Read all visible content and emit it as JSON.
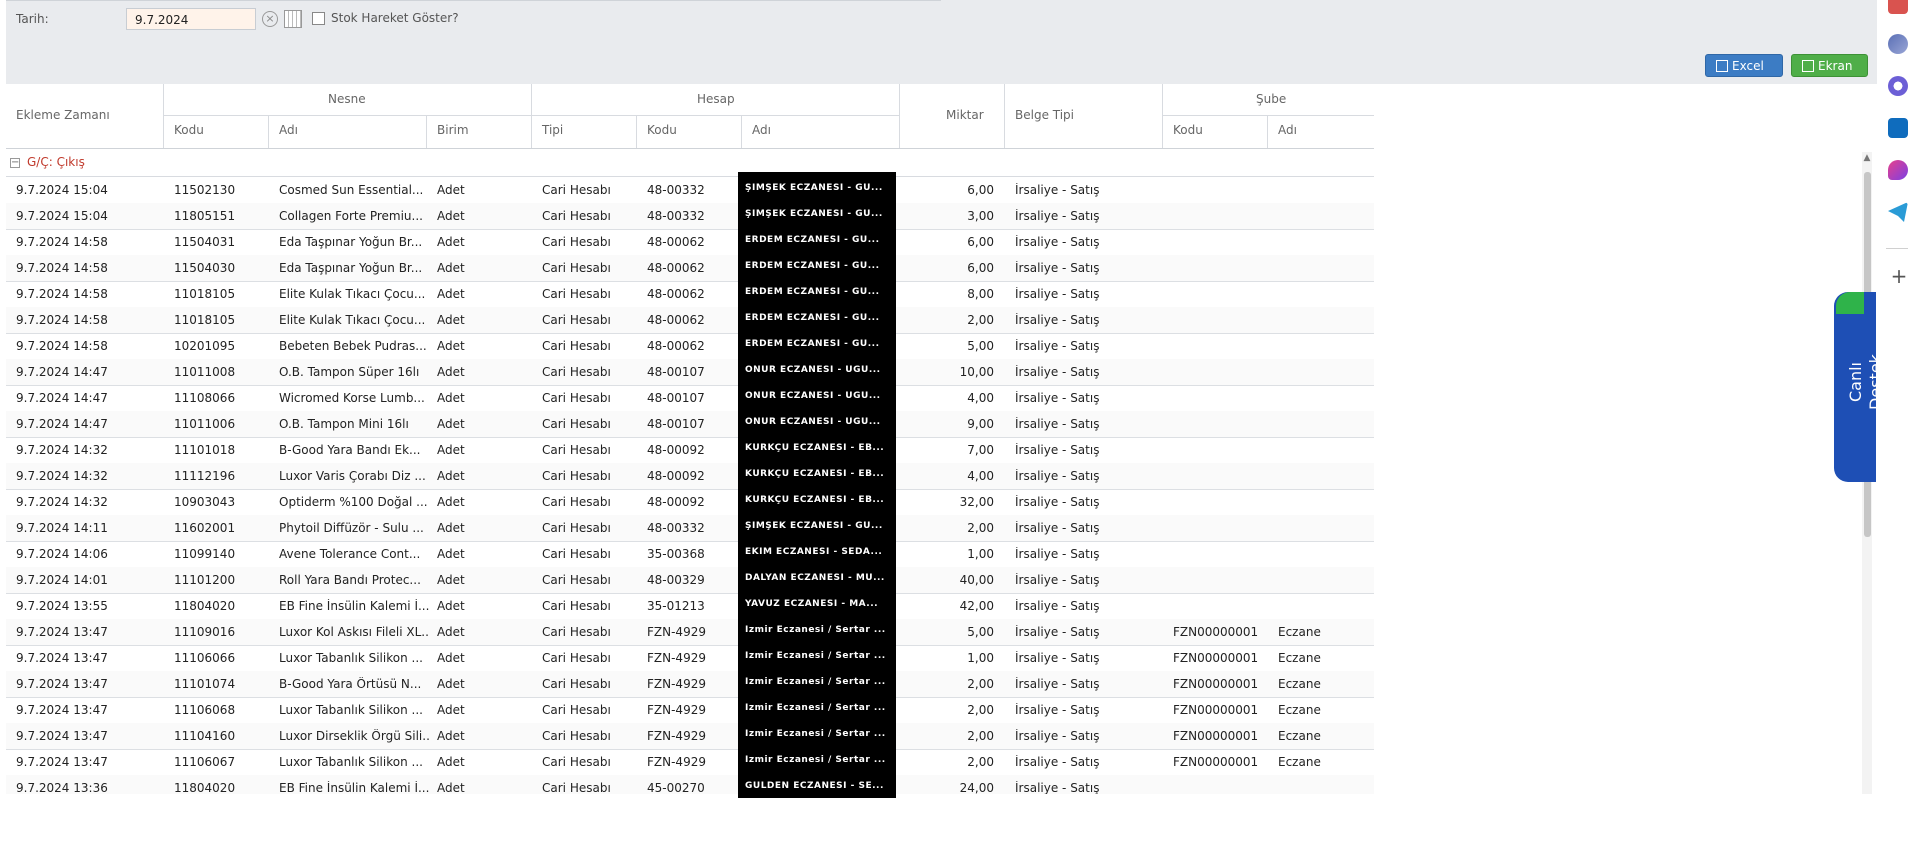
{
  "filter": {
    "date_label": "Tarih:",
    "date_value": "9.7.2024",
    "checkbox_label": "Stok Hareket Göster?"
  },
  "toolbar": {
    "excel_label": "Excel",
    "ekran_label": "Ekran"
  },
  "headers": {
    "ekleme": "Ekleme Zamanı",
    "nesne": "Nesne",
    "nesne_kodu": "Kodu",
    "nesne_adi": "Adı",
    "birim": "Birim",
    "hesap": "Hesap",
    "hesap_tipi": "Tipi",
    "hesap_kodu": "Kodu",
    "hesap_adi": "Adı",
    "miktar": "Miktar",
    "belge_tipi": "Belge Tipi",
    "sube": "Şube",
    "sube_kodu": "Kodu",
    "sube_adi": "Adı"
  },
  "group": {
    "title": "G/Ç: Çıkış",
    "toggle": "−"
  },
  "rows": [
    {
      "time": "9.7.2024 15:04",
      "kod": "11502130",
      "adi": "Cosmed Sun Essential...",
      "birim": "Adet",
      "tipi": "Cari Hesabı",
      "hkod": "48-00332",
      "hadi": "ŞİMŞEK ECZANESİ - GÜ...",
      "miktar": "6,00",
      "belge": "İrsaliye - Satış",
      "skod": "",
      "sadi": ""
    },
    {
      "time": "9.7.2024 15:04",
      "kod": "11805151",
      "adi": "Collagen Forte Premiu...",
      "birim": "Adet",
      "tipi": "Cari Hesabı",
      "hkod": "48-00332",
      "hadi": "ŞİMŞEK ECZANESİ - GÜ...",
      "miktar": "3,00",
      "belge": "İrsaliye - Satış",
      "skod": "",
      "sadi": ""
    },
    {
      "time": "9.7.2024 14:58",
      "kod": "11504031",
      "adi": "Eda Taşpınar Yoğun Br...",
      "birim": "Adet",
      "tipi": "Cari Hesabı",
      "hkod": "48-00062",
      "hadi": "ERDEM ECZANESİ - GÜ...",
      "miktar": "6,00",
      "belge": "İrsaliye - Satış",
      "skod": "",
      "sadi": ""
    },
    {
      "time": "9.7.2024 14:58",
      "kod": "11504030",
      "adi": "Eda Taşpınar Yoğun Br...",
      "birim": "Adet",
      "tipi": "Cari Hesabı",
      "hkod": "48-00062",
      "hadi": "ERDEM ECZANESİ - GÜ...",
      "miktar": "6,00",
      "belge": "İrsaliye - Satış",
      "skod": "",
      "sadi": ""
    },
    {
      "time": "9.7.2024 14:58",
      "kod": "11018105",
      "adi": "Elite Kulak Tıkacı Çocu...",
      "birim": "Adet",
      "tipi": "Cari Hesabı",
      "hkod": "48-00062",
      "hadi": "ERDEM ECZANESİ - GÜ...",
      "miktar": "8,00",
      "belge": "İrsaliye - Satış",
      "skod": "",
      "sadi": ""
    },
    {
      "time": "9.7.2024 14:58",
      "kod": "11018105",
      "adi": "Elite Kulak Tıkacı Çocu...",
      "birim": "Adet",
      "tipi": "Cari Hesabı",
      "hkod": "48-00062",
      "hadi": "ERDEM ECZANESİ - GÜ...",
      "miktar": "2,00",
      "belge": "İrsaliye - Satış",
      "skod": "",
      "sadi": ""
    },
    {
      "time": "9.7.2024 14:58",
      "kod": "10201095",
      "adi": "Bebeten Bebek Pudras...",
      "birim": "Adet",
      "tipi": "Cari Hesabı",
      "hkod": "48-00062",
      "hadi": "ERDEM ECZANESİ - GÜ...",
      "miktar": "5,00",
      "belge": "İrsaliye - Satış",
      "skod": "",
      "sadi": ""
    },
    {
      "time": "9.7.2024 14:47",
      "kod": "11011008",
      "adi": "O.B. Tampon Süper 16lı",
      "birim": "Adet",
      "tipi": "Cari Hesabı",
      "hkod": "48-00107",
      "hadi": "ONUR ECZANESİ - UĞU...",
      "miktar": "10,00",
      "belge": "İrsaliye - Satış",
      "skod": "",
      "sadi": ""
    },
    {
      "time": "9.7.2024 14:47",
      "kod": "11108066",
      "adi": "Wicromed Korse Lumb...",
      "birim": "Adet",
      "tipi": "Cari Hesabı",
      "hkod": "48-00107",
      "hadi": "ONUR ECZANESİ - UĞU...",
      "miktar": "4,00",
      "belge": "İrsaliye - Satış",
      "skod": "",
      "sadi": ""
    },
    {
      "time": "9.7.2024 14:47",
      "kod": "11011006",
      "adi": "O.B. Tampon Mini 16lı",
      "birim": "Adet",
      "tipi": "Cari Hesabı",
      "hkod": "48-00107",
      "hadi": "ONUR ECZANESİ - UĞU...",
      "miktar": "9,00",
      "belge": "İrsaliye - Satış",
      "skod": "",
      "sadi": ""
    },
    {
      "time": "9.7.2024 14:32",
      "kod": "11101018",
      "adi": "B-Good Yara Bandı Ek...",
      "birim": "Adet",
      "tipi": "Cari Hesabı",
      "hkod": "48-00092",
      "hadi": "KÜRKÇÜ ECZANESİ - EB...",
      "miktar": "7,00",
      "belge": "İrsaliye - Satış",
      "skod": "",
      "sadi": ""
    },
    {
      "time": "9.7.2024 14:32",
      "kod": "11112196",
      "adi": "Luxor Varis Çorabı Diz ...",
      "birim": "Adet",
      "tipi": "Cari Hesabı",
      "hkod": "48-00092",
      "hadi": "KÜRKÇÜ ECZANESİ - EB...",
      "miktar": "4,00",
      "belge": "İrsaliye - Satış",
      "skod": "",
      "sadi": ""
    },
    {
      "time": "9.7.2024 14:32",
      "kod": "10903043",
      "adi": "Optiderm %100 Doğal ...",
      "birim": "Adet",
      "tipi": "Cari Hesabı",
      "hkod": "48-00092",
      "hadi": "KÜRKÇÜ ECZANESİ - EB...",
      "miktar": "32,00",
      "belge": "İrsaliye - Satış",
      "skod": "",
      "sadi": ""
    },
    {
      "time": "9.7.2024 14:11",
      "kod": "11602001",
      "adi": "Phytoil Diffüzör - Sulu ...",
      "birim": "Adet",
      "tipi": "Cari Hesabı",
      "hkod": "48-00332",
      "hadi": "ŞİMŞEK ECZANESİ - GÜ...",
      "miktar": "2,00",
      "belge": "İrsaliye - Satış",
      "skod": "",
      "sadi": ""
    },
    {
      "time": "9.7.2024 14:06",
      "kod": "11099140",
      "adi": "Avene Tolerance Cont...",
      "birim": "Adet",
      "tipi": "Cari Hesabı",
      "hkod": "35-00368",
      "hadi": "EKİM ECZANESİ - SEDA...",
      "miktar": "1,00",
      "belge": "İrsaliye - Satış",
      "skod": "",
      "sadi": ""
    },
    {
      "time": "9.7.2024 14:01",
      "kod": "11101200",
      "adi": "Roll Yara Bandı Protec...",
      "birim": "Adet",
      "tipi": "Cari Hesabı",
      "hkod": "48-00329",
      "hadi": "DALYAN ECZANESİ - MU...",
      "miktar": "40,00",
      "belge": "İrsaliye - Satış",
      "skod": "",
      "sadi": ""
    },
    {
      "time": "9.7.2024 13:55",
      "kod": "11804020",
      "adi": "EB Fine İnsülin Kalemi İ...",
      "birim": "Adet",
      "tipi": "Cari Hesabı",
      "hkod": "35-01213",
      "hadi": "YAVUZ ECZANESİ - MA...",
      "miktar": "42,00",
      "belge": "İrsaliye - Satış",
      "skod": "",
      "sadi": ""
    },
    {
      "time": "9.7.2024 13:47",
      "kod": "11109016",
      "adi": "Luxor Kol Askısı Fileli XL...",
      "birim": "Adet",
      "tipi": "Cari Hesabı",
      "hkod": "FZN-4929",
      "hadi": "İzmir Eczanesi / Sertar ...",
      "miktar": "5,00",
      "belge": "İrsaliye - Satış",
      "skod": "FZN00000001",
      "sadi": "Eczane"
    },
    {
      "time": "9.7.2024 13:47",
      "kod": "11106066",
      "adi": "Luxor Tabanlık Silikon ...",
      "birim": "Adet",
      "tipi": "Cari Hesabı",
      "hkod": "FZN-4929",
      "hadi": "İzmir Eczanesi / Sertar ...",
      "miktar": "1,00",
      "belge": "İrsaliye - Satış",
      "skod": "FZN00000001",
      "sadi": "Eczane"
    },
    {
      "time": "9.7.2024 13:47",
      "kod": "11101074",
      "adi": "B-Good Yara Örtüsü N...",
      "birim": "Adet",
      "tipi": "Cari Hesabı",
      "hkod": "FZN-4929",
      "hadi": "İzmir Eczanesi / Sertar ...",
      "miktar": "2,00",
      "belge": "İrsaliye - Satış",
      "skod": "FZN00000001",
      "sadi": "Eczane"
    },
    {
      "time": "9.7.2024 13:47",
      "kod": "11106068",
      "adi": "Luxor Tabanlık Silikon ...",
      "birim": "Adet",
      "tipi": "Cari Hesabı",
      "hkod": "FZN-4929",
      "hadi": "İzmir Eczanesi / Sertar ...",
      "miktar": "2,00",
      "belge": "İrsaliye - Satış",
      "skod": "FZN00000001",
      "sadi": "Eczane"
    },
    {
      "time": "9.7.2024 13:47",
      "kod": "11104160",
      "adi": "Luxor Dirseklik Örgü Sili...",
      "birim": "Adet",
      "tipi": "Cari Hesabı",
      "hkod": "FZN-4929",
      "hadi": "İzmir Eczanesi / Sertar ...",
      "miktar": "2,00",
      "belge": "İrsaliye - Satış",
      "skod": "FZN00000001",
      "sadi": "Eczane"
    },
    {
      "time": "9.7.2024 13:47",
      "kod": "11106067",
      "adi": "Luxor Tabanlık Silikon ...",
      "birim": "Adet",
      "tipi": "Cari Hesabı",
      "hkod": "FZN-4929",
      "hadi": "İzmir Eczanesi / Sertar ...",
      "miktar": "2,00",
      "belge": "İrsaliye - Satış",
      "skod": "FZN00000001",
      "sadi": "Eczane"
    },
    {
      "time": "9.7.2024 13:36",
      "kod": "11804020",
      "adi": "EB Fine İnsülin Kalemi İ...",
      "birim": "Adet",
      "tipi": "Cari Hesabı",
      "hkod": "45-00270",
      "hadi": "GÜLDEN ECZANESİ - SE...",
      "miktar": "24,00",
      "belge": "İrsaliye - Satış",
      "skod": "",
      "sadi": ""
    }
  ],
  "live_support": {
    "label": "Canlı Destek"
  },
  "colors": {
    "accent_red": "#c0392b",
    "excel_blue": "#3c7cc4",
    "ekran_green": "#4fae48",
    "live_blue": "#1e4fb5"
  },
  "sidebar_icons": [
    "briefcase-icon",
    "people-icon",
    "copilot-icon",
    "outlook-icon",
    "designer-icon",
    "telegram-icon"
  ]
}
